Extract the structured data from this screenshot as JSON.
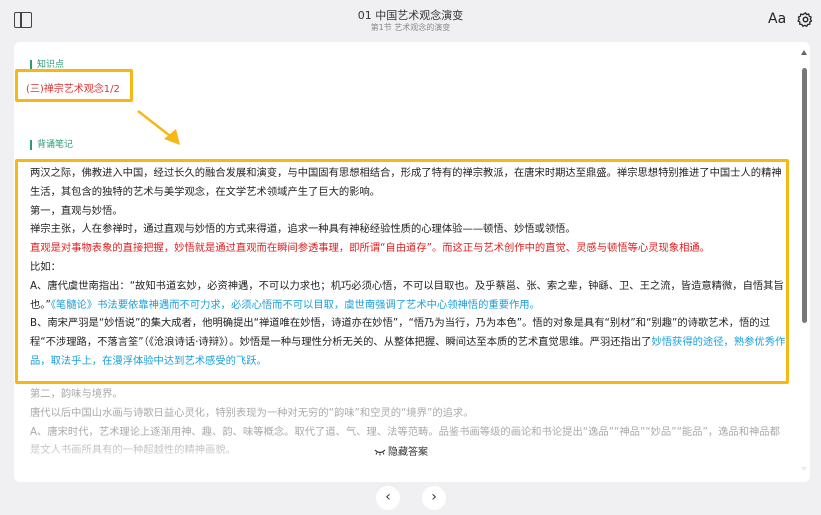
{
  "header": {
    "title": "01 中国艺术观念演变",
    "subtitle": "第1节 艺术观念的演变",
    "font_button_label": "Aa"
  },
  "knowledge": {
    "section_label": "知识点",
    "point": "(三)禅宗艺术观念1/2"
  },
  "notes": {
    "section_label": "背诵笔记",
    "p1": "两汉之际，佛教进入中国，经过长久的融合发展和演变，与中国固有思想相结合，形成了特有的禅宗教派，在唐宋时期达至鼎盛。禅宗思想特别推进了中国士人的精神生活，其包含的独特的艺术与美学观念，在文学艺术领域产生了巨大的影响。",
    "p2": "第一，直观与妙悟。",
    "p3": "禅宗主张，人在参禅时，通过直观与妙悟的方式来得道，追求一种具有神秘经验性质的心理体验——顿悟、妙悟或领悟。",
    "p4": "直观是对事物表象的直接把握，妙悟就是通过直观而在瞬间参透事理，即所谓“自由道存”。而这正与艺术创作中的直觉、灵感与顿悟等心灵现象相通。",
    "p5": "比如：",
    "p6a": "A、唐代虞世南指出：“故知书道玄妙，必资神遇，不可以力求也；机巧必须心悟，不可以目取也。及乎蔡邕、张、索之辈，钟繇、卫、王之流，皆造意精微，自悟其旨也。”",
    "p6b": "《笔髓论》书法要依靠神遇而不可力求，必须心悟而不可以目取，虞世南强调了艺术中心领神悟的重要作用。",
    "p7a": "B、南宋严羽是“妙悟说”的集大成者，他明确提出“禅道唯在妙悟，诗道亦在妙悟”，“悟乃为当行，乃为本色”。悟的对象是具有“别材”和“别趣”的诗歌艺术，悟的过程“不涉理路，不落言筌”（《沧浪诗话·诗辩》）。妙悟是一种与理性分析无关的、从整体把握、瞬间达至本质的艺术直觉思维。严羽还指出了",
    "p7b": "妙悟获得的途径，熟参优秀作品，取法乎上，在漫浮体验中达到艺术感受的飞跃。"
  },
  "faded": {
    "f1": "第二，韵味与境界。",
    "f2": "唐代以后中国山水画与诗歌日益心灵化，特别表现为一种对无穷的“韵味”和空灵的“境界”的追求。",
    "f3": "A、唐宋时代，艺术理论上逐渐用神、趣、韵、味等概念。取代了道、气、理、法等范畴。品鉴书画等级的画论和书论提出“逸品”“神品”“妙品”“能品”，逸品和神品都是文人书画所具有的一种超越性的精神画貌。"
  },
  "hide_answer": {
    "label": "隐藏答案"
  },
  "nav": {
    "prev": "‹",
    "next": "›"
  }
}
